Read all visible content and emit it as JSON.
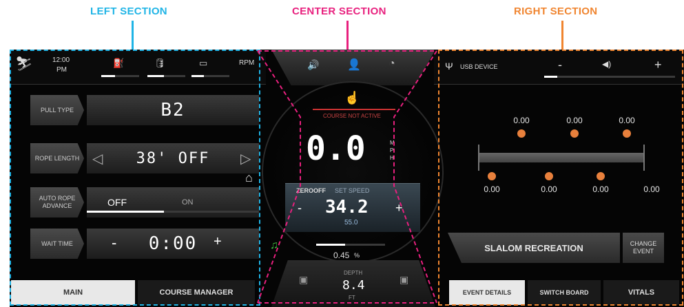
{
  "section_labels": {
    "left": "LEFT SECTION",
    "center": "CENTER SECTION",
    "right": "RIGHT SECTION"
  },
  "status_bar": {
    "time": "12:00",
    "ampm": "PM",
    "rpm_label": "RPM"
  },
  "rows": {
    "pull_type": {
      "label": "PULL TYPE",
      "value": "B2"
    },
    "rope_length": {
      "label": "ROPE LENGTH",
      "value": "38' OFF"
    },
    "auto_rope_advance": {
      "label": "AUTO ROPE ADVANCE",
      "off": "OFF",
      "on": "ON",
      "progress": 0.45
    },
    "wait_time": {
      "label": "WAIT TIME",
      "value": "0:00",
      "minus": "-",
      "plus": "+"
    }
  },
  "tabs_left": {
    "main": "MAIN",
    "course_manager": "COURSE MANAGER"
  },
  "center": {
    "course_status": "COURSE NOT ACTIVE",
    "speed": "0.0",
    "speed_unit": "MPH",
    "zero_off": "ZEROOFF",
    "set_speed_label": "SET SPEED",
    "set_speed": "34.2",
    "sub_speed": "55.0",
    "percent": "0.45",
    "percent_unit": "%",
    "depth_label": "DEPTH",
    "depth": "8.4",
    "depth_unit": "FT",
    "minus": "-",
    "plus": "+"
  },
  "right": {
    "usb_label": "USB DEVICE",
    "volume_minus": "-",
    "volume_plus": "+",
    "volume_level": 0.1,
    "top_values": [
      "0.00",
      "0.00",
      "0.00"
    ],
    "bottom_values": [
      "0.00",
      "0.00",
      "0.00",
      "0.00"
    ],
    "event_name": "SLALOM RECREATION",
    "change_event": "CHANGE EVENT",
    "tabs": {
      "event_details": "EVENT DETAILS",
      "switch_board": "SWITCH BOARD",
      "vitals": "VITALS"
    }
  },
  "colors": {
    "left": "#1fb4e6",
    "center": "#e8207e",
    "right": "#f08530",
    "dot": "#e8803c"
  }
}
